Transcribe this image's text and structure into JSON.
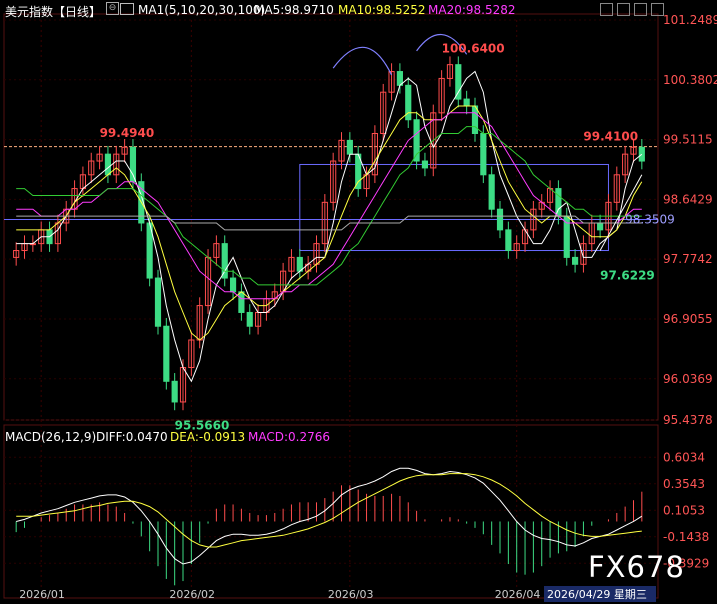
{
  "header": {
    "title": "美元指数【日线】",
    "ma_params": "MA1(5,10,20,30,100)",
    "ma5": "MA5:98.9710",
    "ma10": "MA10:98.5252",
    "ma20": "MA20:98.5282"
  },
  "macd_header": {
    "params": "MACD(26,12,9)",
    "diff": "DIFF:0.0470",
    "dea": "DEA:-0.0913",
    "macd": "MACD:0.2766"
  },
  "colors": {
    "up": "#ff4d4d",
    "down": "#3ddc84",
    "ma5": "#ffffff",
    "ma10": "#ffff40",
    "ma20": "#ff3cff",
    "ma30": "#33cc33",
    "ma100": "#aaaaaa",
    "axis_text": "#ff5555",
    "grid": "#2a0000",
    "ref_line": "#ffb080",
    "box": "#6a6aff"
  },
  "chart_data": [
    {
      "type": "candlestick",
      "y_ticks": [
        "101.2489",
        "100.3802",
        "99.5115",
        "98.6429",
        "97.7742",
        "96.9055",
        "96.0369",
        "95.4378"
      ],
      "ylim": [
        95.4378,
        101.2489
      ],
      "x_ticks": [
        "2026/01",
        "2026/02",
        "2026/03",
        "2026/04"
      ],
      "cursor_date": "2026/04/29 星期三",
      "annotations": {
        "high_jan": "99.4940",
        "low_feb": "95.5660",
        "high_mar": "100.6400",
        "high_apr": "99.4100",
        "low_apr": "97.6229",
        "level_label": "98.3509"
      },
      "series": [
        {
          "name": "MA5",
          "values": [
            98.0,
            98.0,
            98.0,
            98.1,
            98.1,
            98.2,
            98.4,
            98.6,
            98.8,
            98.9,
            99.0,
            99.1,
            99.2,
            99.2,
            99.0,
            98.7,
            98.3,
            97.8,
            97.1,
            96.6,
            96.2,
            96.0,
            96.3,
            96.9,
            97.4,
            97.6,
            97.8,
            97.5,
            97.2,
            97.0,
            97.0,
            97.1,
            97.3,
            97.5,
            97.6,
            97.7,
            97.8,
            97.8,
            98.3,
            98.9,
            99.3,
            99.3,
            99.0,
            99.1,
            99.5,
            99.9,
            100.3,
            100.4,
            100.3,
            99.7,
            99.4,
            99.6,
            100.0,
            100.2,
            100.4,
            100.5,
            100.2,
            99.5,
            99.0,
            98.7,
            98.4,
            98.2,
            98.0,
            98.0,
            98.2,
            98.5,
            98.6,
            98.2,
            97.8,
            97.8,
            98.0,
            98.1,
            98.2,
            98.8,
            99.2,
            99.3
          ]
        },
        {
          "name": "MA10",
          "values": [
            98.2,
            98.2,
            98.2,
            98.2,
            98.2,
            98.3,
            98.4,
            98.6,
            98.7,
            98.8,
            98.9,
            99.0,
            99.1,
            99.0,
            98.8,
            98.6,
            98.4,
            98.1,
            97.7,
            97.3,
            97.0,
            96.7,
            96.6,
            96.7,
            96.9,
            97.1,
            97.2,
            97.3,
            97.2,
            97.1,
            97.1,
            97.2,
            97.3,
            97.4,
            97.5,
            97.6,
            97.7,
            97.8,
            98.1,
            98.4,
            98.7,
            98.9,
            99.0,
            99.2,
            99.4,
            99.6,
            99.8,
            99.9,
            99.9,
            99.8,
            99.8,
            99.8,
            99.9,
            100.0,
            100.0,
            100.0,
            99.8,
            99.5,
            99.2,
            98.9,
            98.7,
            98.5,
            98.4,
            98.3,
            98.4,
            98.4,
            98.4,
            98.3,
            98.2,
            98.1,
            98.1,
            98.1,
            98.2,
            98.4,
            98.7,
            98.9
          ]
        },
        {
          "name": "MA20",
          "values": [
            98.5,
            98.5,
            98.5,
            98.4,
            98.4,
            98.4,
            98.5,
            98.5,
            98.6,
            98.6,
            98.7,
            98.8,
            98.8,
            98.9,
            98.9,
            98.8,
            98.7,
            98.6,
            98.4,
            98.2,
            98.0,
            97.8,
            97.6,
            97.5,
            97.4,
            97.3,
            97.3,
            97.2,
            97.2,
            97.2,
            97.2,
            97.2,
            97.3,
            97.3,
            97.4,
            97.4,
            97.5,
            97.6,
            97.7,
            97.9,
            98.1,
            98.3,
            98.5,
            98.7,
            98.9,
            99.1,
            99.3,
            99.5,
            99.6,
            99.7,
            99.8,
            99.8,
            99.9,
            99.9,
            99.9,
            99.9,
            99.8,
            99.7,
            99.5,
            99.3,
            99.1,
            98.9,
            98.7,
            98.6,
            98.5,
            98.4,
            98.3,
            98.3,
            98.3,
            98.3,
            98.3,
            98.3,
            98.3,
            98.4,
            98.5,
            98.5
          ]
        },
        {
          "name": "MA30",
          "values": [
            98.8,
            98.8,
            98.7,
            98.7,
            98.7,
            98.7,
            98.7,
            98.7,
            98.7,
            98.7,
            98.7,
            98.8,
            98.8,
            98.8,
            98.8,
            98.7,
            98.6,
            98.5,
            98.4,
            98.3,
            98.1,
            98.0,
            97.9,
            97.8,
            97.7,
            97.6,
            97.6,
            97.5,
            97.5,
            97.4,
            97.4,
            97.4,
            97.4,
            97.4,
            97.4,
            97.4,
            97.4,
            97.5,
            97.6,
            97.7,
            97.9,
            98.0,
            98.2,
            98.4,
            98.6,
            98.8,
            99.0,
            99.1,
            99.3,
            99.4,
            99.5,
            99.6,
            99.6,
            99.6,
            99.7,
            99.7,
            99.6,
            99.6,
            99.5,
            99.4,
            99.3,
            99.2,
            99.0,
            98.9,
            98.8,
            98.7,
            98.6,
            98.5,
            98.5,
            98.4,
            98.4,
            98.4,
            98.4,
            98.4,
            98.4,
            98.4
          ]
        },
        {
          "name": "MA100",
          "values": [
            98.4,
            98.4,
            98.4,
            98.4,
            98.4,
            98.4,
            98.4,
            98.4,
            98.4,
            98.4,
            98.4,
            98.4,
            98.4,
            98.4,
            98.4,
            98.4,
            98.4,
            98.4,
            98.4,
            98.3,
            98.3,
            98.3,
            98.3,
            98.3,
            98.3,
            98.2,
            98.2,
            98.2,
            98.2,
            98.2,
            98.2,
            98.2,
            98.2,
            98.2,
            98.2,
            98.2,
            98.2,
            98.2,
            98.2,
            98.2,
            98.3,
            98.3,
            98.3,
            98.3,
            98.3,
            98.3,
            98.3,
            98.4,
            98.4,
            98.4,
            98.4,
            98.4,
            98.4,
            98.4,
            98.4,
            98.4,
            98.4,
            98.4,
            98.4,
            98.4,
            98.4,
            98.4,
            98.4,
            98.4,
            98.4,
            98.4,
            98.4,
            98.4,
            98.3,
            98.3,
            98.3,
            98.3,
            98.3,
            98.3,
            98.3,
            98.3
          ]
        }
      ],
      "closes": [
        97.9,
        98.0,
        98.0,
        98.2,
        98.0,
        98.3,
        98.5,
        98.8,
        99.0,
        99.2,
        99.3,
        99.0,
        99.3,
        99.4,
        98.9,
        98.3,
        97.5,
        96.8,
        96.0,
        95.7,
        96.2,
        96.6,
        97.1,
        97.8,
        98.0,
        97.5,
        97.3,
        97.0,
        96.8,
        97.0,
        97.2,
        97.3,
        97.6,
        97.8,
        97.6,
        97.7,
        98.0,
        98.6,
        99.2,
        99.5,
        99.3,
        98.8,
        99.0,
        99.6,
        100.2,
        100.5,
        100.3,
        99.8,
        99.2,
        99.1,
        99.9,
        100.4,
        100.6,
        100.1,
        100.0,
        99.6,
        99.0,
        98.5,
        98.2,
        97.9,
        98.0,
        98.2,
        98.5,
        98.6,
        98.8,
        98.4,
        97.8,
        97.7,
        98.0,
        98.3,
        98.2,
        98.6,
        99.0,
        99.3,
        99.4,
        99.2
      ],
      "opens": [
        97.8,
        97.9,
        98.0,
        98.0,
        98.2,
        98.0,
        98.3,
        98.5,
        98.8,
        99.0,
        99.2,
        99.3,
        99.0,
        99.3,
        99.4,
        98.9,
        98.3,
        97.5,
        96.8,
        96.0,
        95.7,
        96.2,
        96.6,
        97.1,
        97.8,
        98.0,
        97.5,
        97.3,
        97.0,
        96.8,
        97.0,
        97.2,
        97.3,
        97.6,
        97.8,
        97.6,
        97.7,
        98.0,
        98.6,
        99.2,
        99.5,
        99.3,
        98.8,
        99.0,
        99.6,
        100.2,
        100.5,
        100.3,
        99.8,
        99.2,
        99.1,
        99.9,
        100.4,
        100.6,
        100.1,
        100.0,
        99.6,
        99.0,
        98.5,
        98.2,
        97.9,
        98.0,
        98.2,
        98.5,
        98.6,
        98.8,
        98.4,
        97.8,
        97.7,
        98.0,
        98.3,
        98.2,
        98.6,
        99.0,
        99.3,
        99.4
      ]
    },
    {
      "type": "bar",
      "y_ticks": [
        "0.6034",
        "0.3543",
        "0.1053",
        "-0.1438",
        "-0.3929"
      ],
      "ylim": [
        -0.55,
        0.7
      ],
      "series": [
        {
          "name": "DIFF",
          "values": [
            0.0,
            0.02,
            0.05,
            0.08,
            0.1,
            0.12,
            0.15,
            0.18,
            0.2,
            0.22,
            0.24,
            0.25,
            0.25,
            0.23,
            0.18,
            0.1,
            0.0,
            -0.12,
            -0.25,
            -0.35,
            -0.4,
            -0.38,
            -0.32,
            -0.25,
            -0.18,
            -0.14,
            -0.12,
            -0.12,
            -0.13,
            -0.13,
            -0.12,
            -0.1,
            -0.07,
            -0.03,
            0.0,
            0.02,
            0.05,
            0.1,
            0.17,
            0.25,
            0.3,
            0.33,
            0.35,
            0.38,
            0.42,
            0.47,
            0.5,
            0.5,
            0.48,
            0.45,
            0.44,
            0.45,
            0.47,
            0.46,
            0.44,
            0.41,
            0.36,
            0.28,
            0.2,
            0.1,
            0.0,
            -0.08,
            -0.13,
            -0.16,
            -0.17,
            -0.19,
            -0.22,
            -0.23,
            -0.2,
            -0.16,
            -0.14,
            -0.12,
            -0.08,
            -0.04,
            0.0,
            0.05
          ]
        },
        {
          "name": "DEA",
          "values": [
            0.05,
            0.05,
            0.05,
            0.06,
            0.07,
            0.08,
            0.09,
            0.1,
            0.12,
            0.14,
            0.15,
            0.17,
            0.18,
            0.19,
            0.19,
            0.17,
            0.14,
            0.09,
            0.02,
            -0.05,
            -0.12,
            -0.18,
            -0.22,
            -0.24,
            -0.24,
            -0.22,
            -0.2,
            -0.18,
            -0.17,
            -0.16,
            -0.15,
            -0.14,
            -0.13,
            -0.11,
            -0.09,
            -0.07,
            -0.04,
            -0.01,
            0.03,
            0.08,
            0.13,
            0.18,
            0.22,
            0.26,
            0.3,
            0.34,
            0.38,
            0.41,
            0.43,
            0.44,
            0.44,
            0.44,
            0.45,
            0.45,
            0.45,
            0.44,
            0.42,
            0.39,
            0.35,
            0.3,
            0.24,
            0.17,
            0.11,
            0.05,
            0.0,
            -0.04,
            -0.08,
            -0.11,
            -0.13,
            -0.14,
            -0.14,
            -0.13,
            -0.12,
            -0.11,
            -0.1,
            -0.09
          ]
        },
        {
          "name": "MACD",
          "values": [
            -0.1,
            -0.06,
            0.0,
            0.04,
            0.06,
            0.08,
            0.12,
            0.16,
            0.16,
            0.16,
            0.18,
            0.16,
            0.14,
            0.08,
            -0.02,
            -0.14,
            -0.28,
            -0.42,
            -0.54,
            -0.6,
            -0.56,
            -0.4,
            -0.2,
            -0.02,
            0.12,
            0.16,
            0.16,
            0.12,
            0.08,
            0.06,
            0.06,
            0.08,
            0.12,
            0.16,
            0.18,
            0.18,
            0.18,
            0.22,
            0.28,
            0.34,
            0.34,
            0.3,
            0.26,
            0.24,
            0.24,
            0.26,
            0.24,
            0.18,
            0.1,
            0.02,
            0.0,
            0.02,
            0.04,
            0.02,
            -0.02,
            -0.06,
            -0.12,
            -0.22,
            -0.3,
            -0.4,
            -0.48,
            -0.5,
            -0.48,
            -0.42,
            -0.34,
            -0.3,
            -0.28,
            -0.24,
            -0.14,
            -0.04,
            0.0,
            0.02,
            0.08,
            0.14,
            0.2,
            0.28
          ]
        }
      ]
    }
  ],
  "watermark": "FX678"
}
